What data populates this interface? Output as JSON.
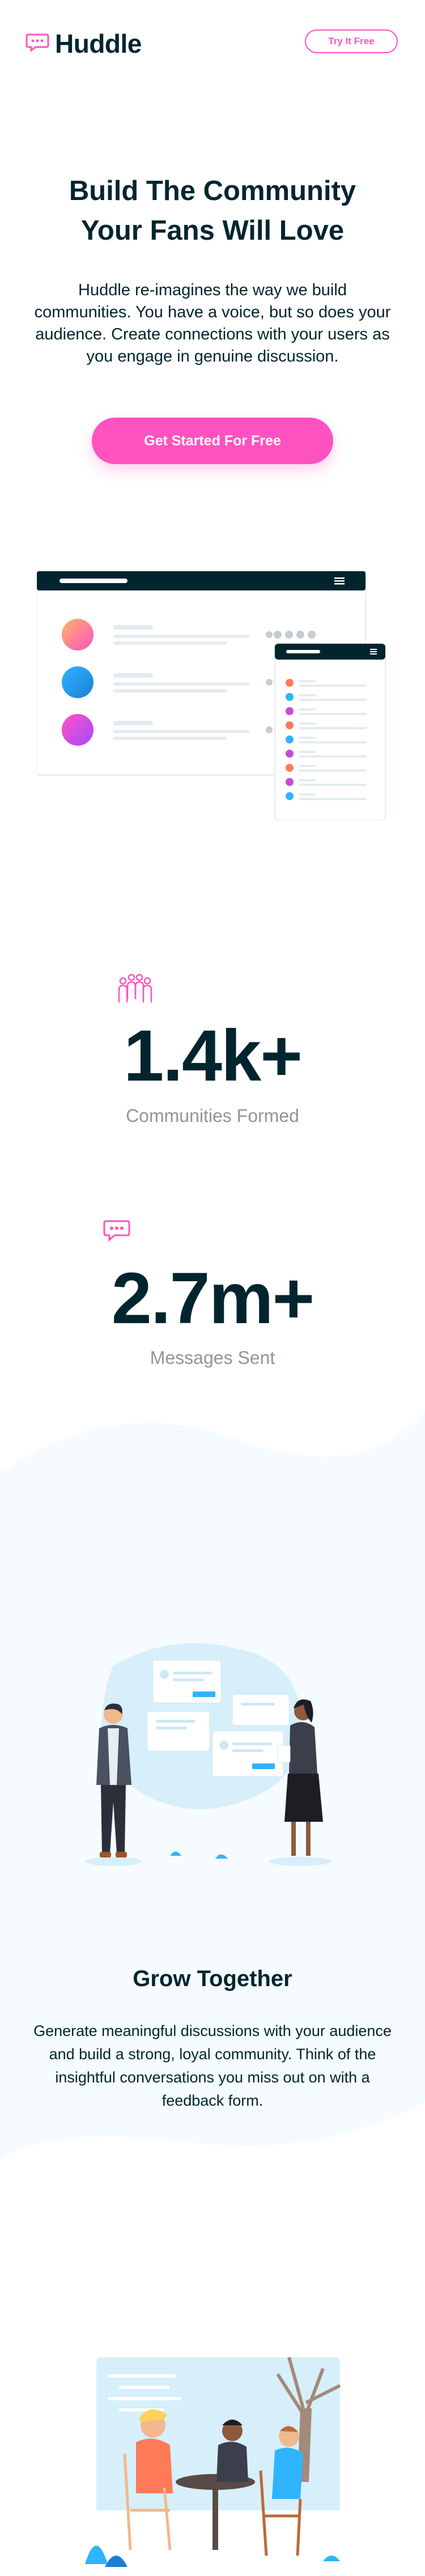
{
  "header": {
    "brand": "Huddle",
    "try_button": "Try It Free"
  },
  "hero": {
    "title_line1": "Build The Community",
    "title_line2": "Your Fans Will Love",
    "text": "Huddle re-imagines the way we build communities. You have a voice, but so does your audience. Create connections with your users as you engage in genuine discussion.",
    "cta": "Get Started For Free"
  },
  "stats": [
    {
      "value": "1.4k+",
      "label": "Communities Formed",
      "icon": "communities-icon"
    },
    {
      "value": "2.7m+",
      "label": "Messages Sent",
      "icon": "messages-icon"
    }
  ],
  "features": [
    {
      "title": "Grow Together",
      "text": "Generate meaningful discussions with your audience and build a strong, loyal community. Think of the insightful conversations you miss out on with a feedback form.",
      "illustration": "grow-together-illustration"
    },
    {
      "illustration": "flowing-conversations-illustration"
    }
  ],
  "colors": {
    "brand_pink": "#ff52c1",
    "dark_blue": "#00252e",
    "section_bg": "#f5fbff",
    "gray": "#8e969a"
  }
}
